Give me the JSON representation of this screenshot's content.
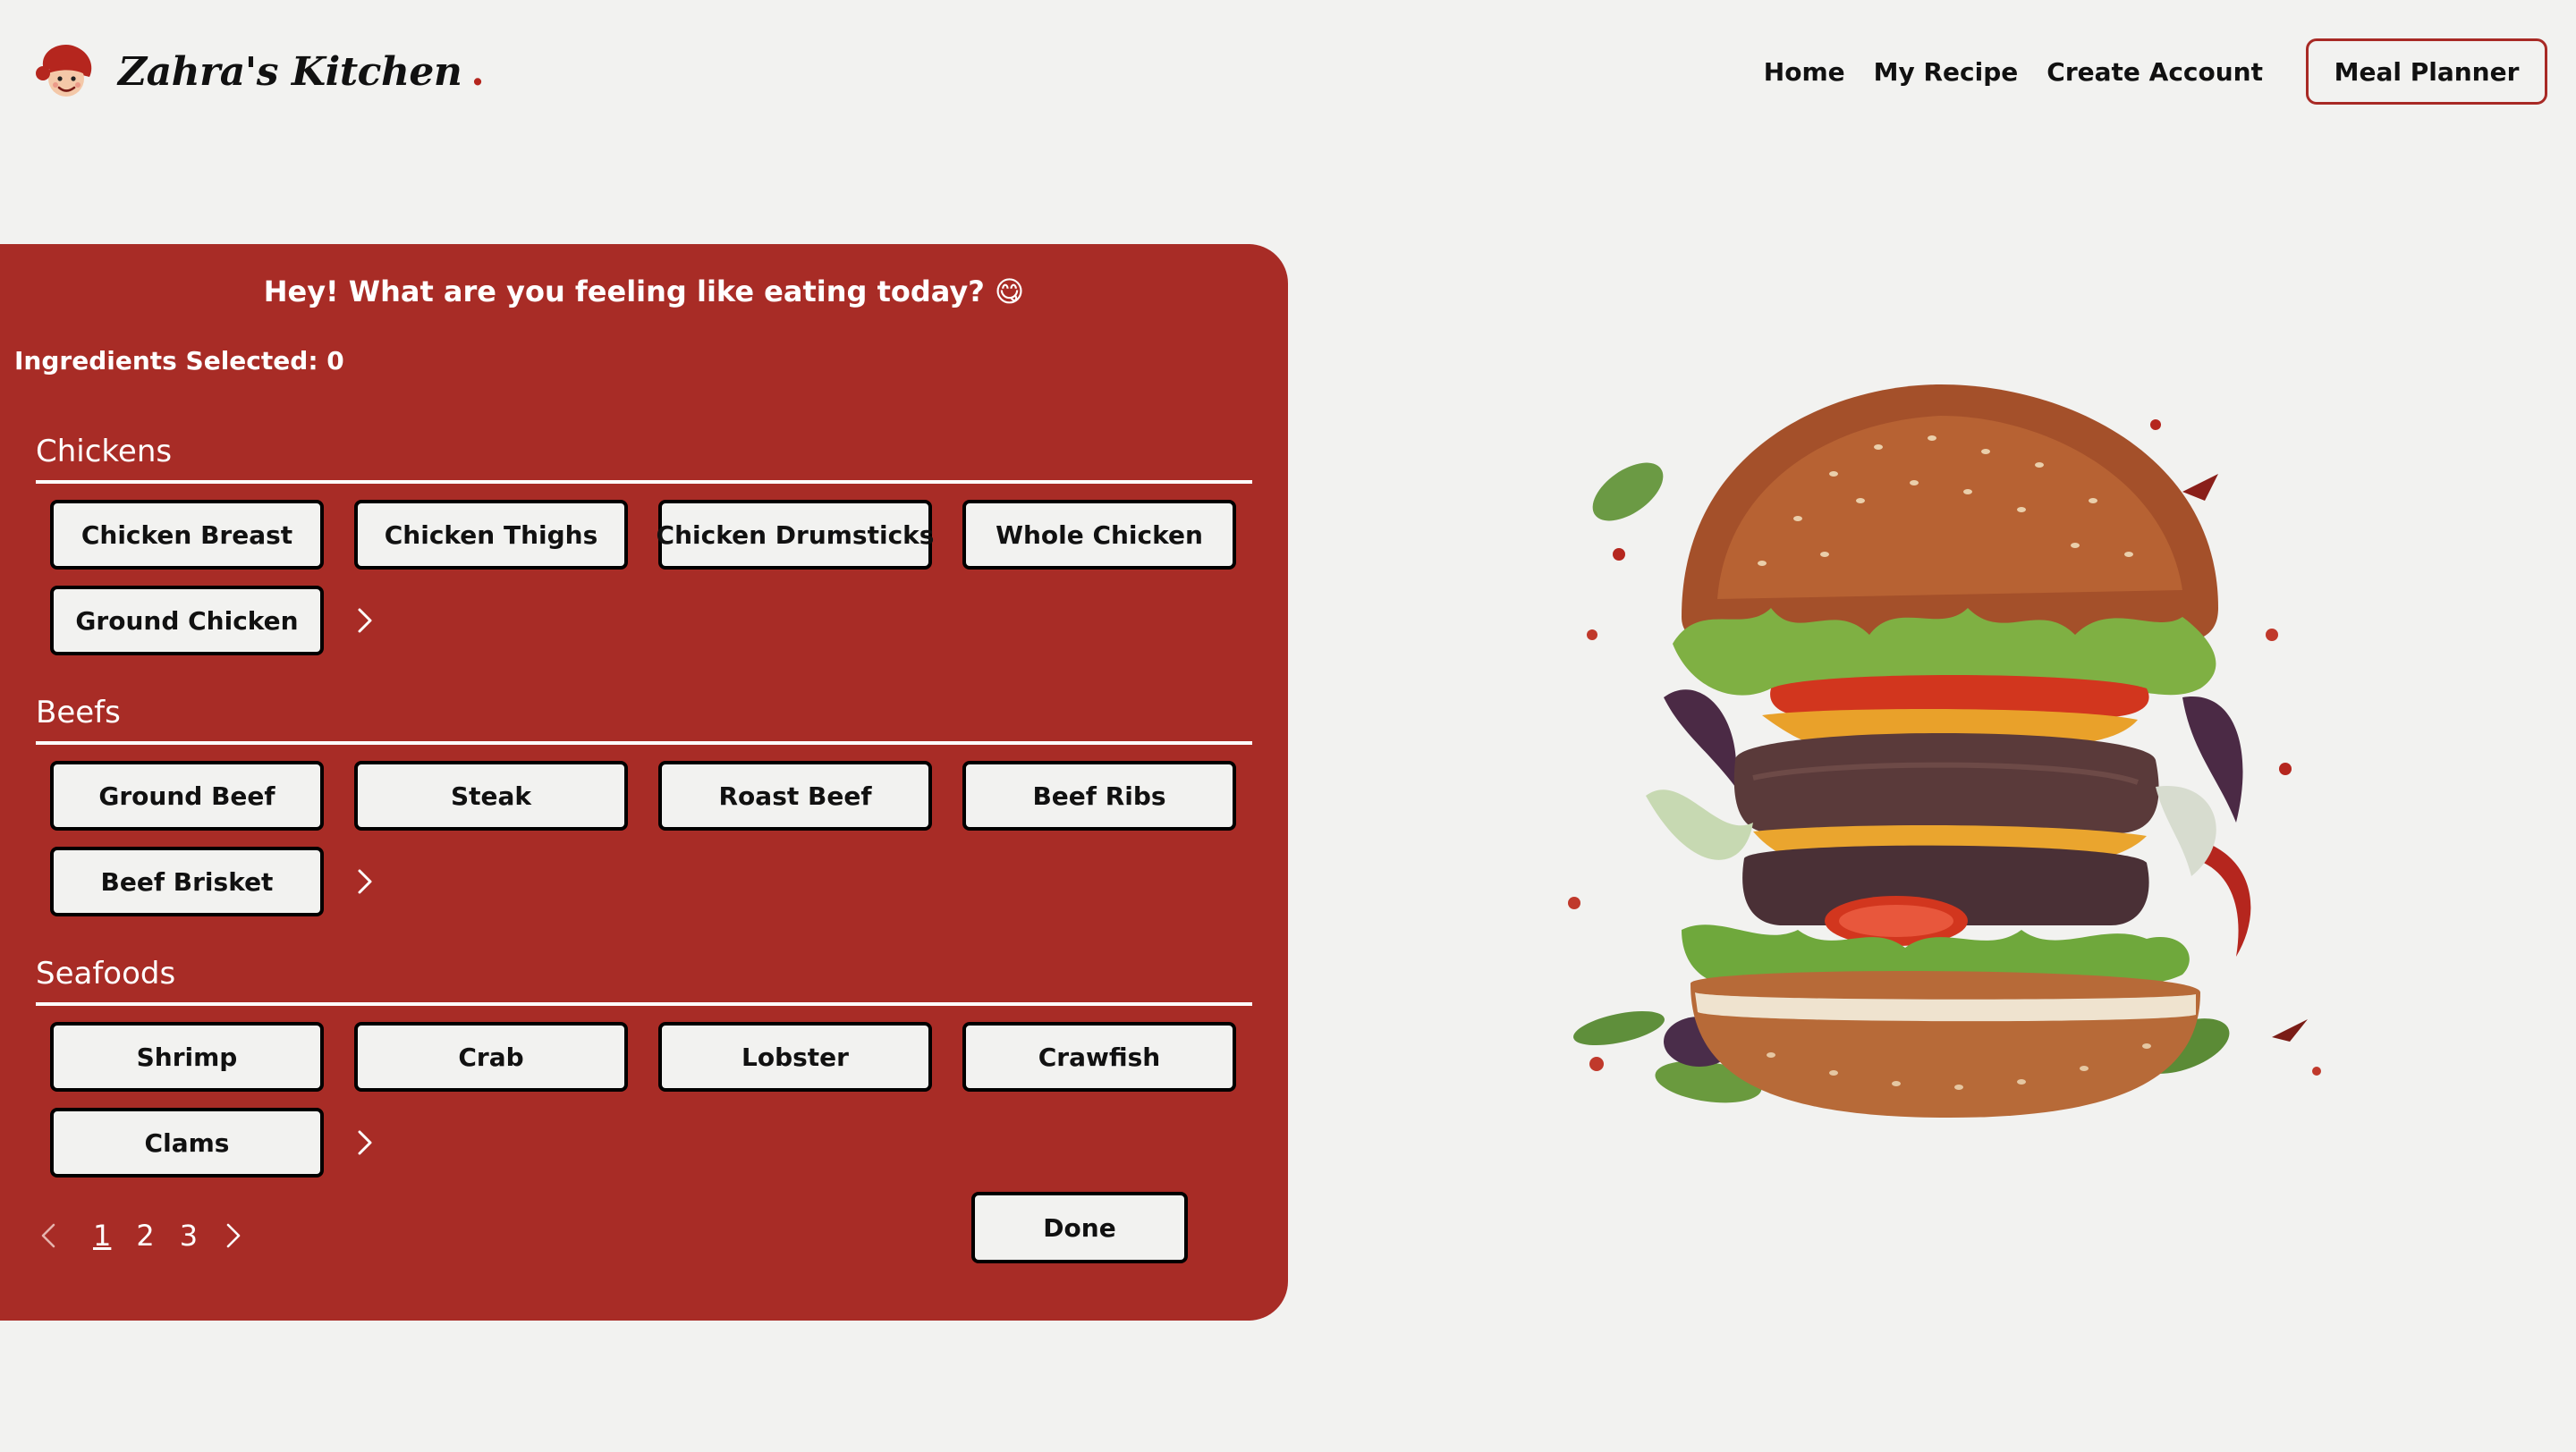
{
  "header": {
    "brand": "Zahra's Kitchen",
    "brand_dot": ".",
    "logo_icon": "chef-face-icon",
    "nav": {
      "home": "Home",
      "my_recipe": "My Recipe",
      "create_account": "Create Account",
      "meal_planner": "Meal Planner"
    }
  },
  "panel": {
    "greeting": "Hey! What are you feeling like eating today? 😋",
    "counter_label": "Ingredients Selected: 0",
    "sections": [
      {
        "title": "Chickens",
        "items": [
          "Chicken Breast",
          "Chicken Thighs",
          "Chicken Drumsticks",
          "Whole Chicken",
          "Ground Chicken"
        ]
      },
      {
        "title": "Beefs",
        "items": [
          "Ground Beef",
          "Steak",
          "Roast Beef",
          "Beef Ribs",
          "Beef Brisket"
        ]
      },
      {
        "title": "Seafoods",
        "items": [
          "Shrimp",
          "Crab",
          "Lobster",
          "Crawfish",
          "Clams"
        ]
      }
    ],
    "more_icon": "chevron-right-icon",
    "pagination": {
      "prev_icon": "chevron-left-icon",
      "pages": [
        "1",
        "2",
        "3"
      ],
      "current_page": "1",
      "next_icon": "chevron-right-icon"
    },
    "done_label": "Done"
  },
  "colors": {
    "panel_red": "#a82c26",
    "accent_red": "#b5261e",
    "page_bg": "#f2f2f0",
    "button_bg": "#f2f2f0"
  },
  "illustration": {
    "icon": "burger-illustration"
  }
}
